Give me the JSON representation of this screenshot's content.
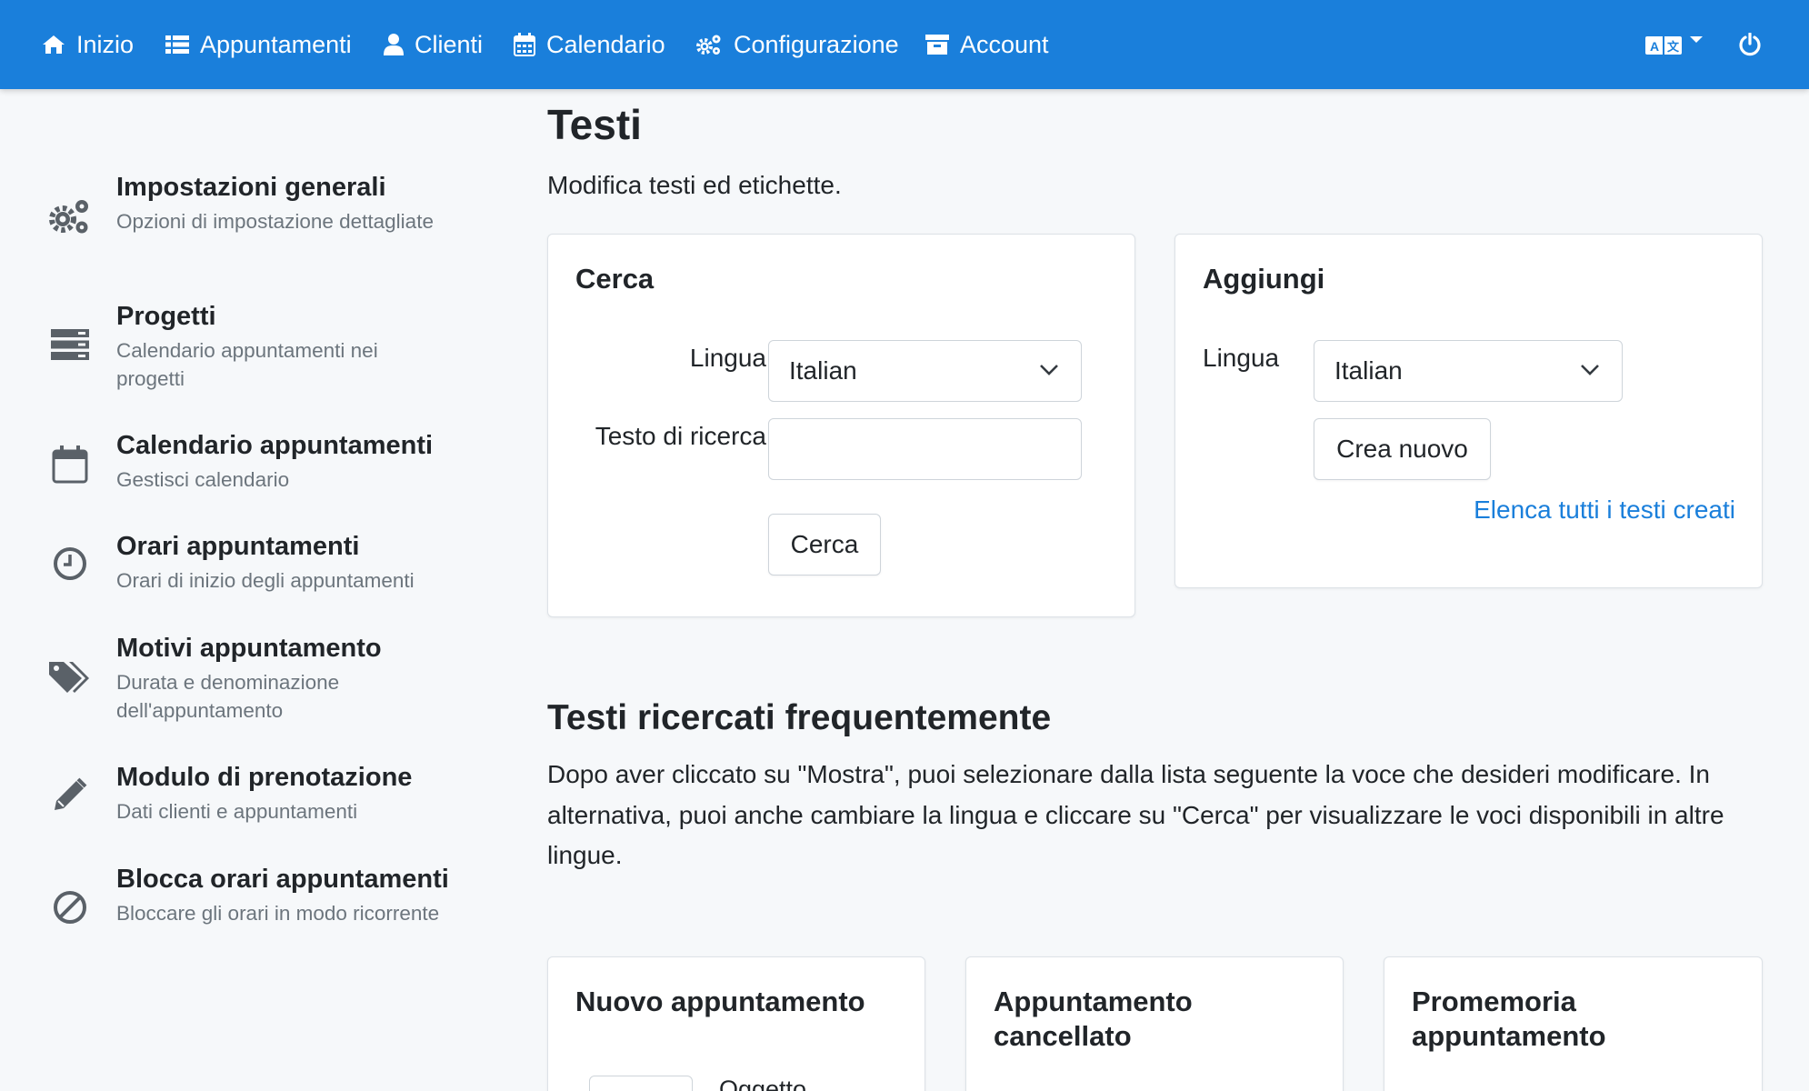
{
  "nav": {
    "items": [
      {
        "label": "Inizio",
        "icon": "home-icon"
      },
      {
        "label": "Appuntamenti",
        "icon": "list-icon"
      },
      {
        "label": "Clienti",
        "icon": "user-icon"
      },
      {
        "label": "Calendario",
        "icon": "calendar-icon"
      },
      {
        "label": "Configurazione",
        "icon": "cogs-icon"
      },
      {
        "label": "Account",
        "icon": "archive-icon"
      }
    ],
    "language_icon": "language-icon",
    "power_icon": "power-icon"
  },
  "sidebar": {
    "items": [
      {
        "title": "Impostazioni generali",
        "desc": "Opzioni di impostazione dettagliate",
        "icon": "cogs-icon"
      },
      {
        "title": "Progetti",
        "desc": "Calendario appuntamenti nei progetti",
        "icon": "server-icon"
      },
      {
        "title": "Calendario appuntamenti",
        "desc": "Gestisci calendario",
        "icon": "calendar-icon"
      },
      {
        "title": "Orari appuntamenti",
        "desc": "Orari di inizio degli appuntamenti",
        "icon": "clock-icon"
      },
      {
        "title": "Motivi appuntamento",
        "desc": "Durata e denominazione dell'appuntamento",
        "icon": "tags-icon"
      },
      {
        "title": "Modulo di prenotazione",
        "desc": "Dati clienti e appuntamenti",
        "icon": "pencil-icon"
      },
      {
        "title": "Blocca orari appuntamenti",
        "desc": "Bloccare gli orari in modo ricorrente",
        "icon": "ban-icon"
      }
    ]
  },
  "main": {
    "title": "Testi",
    "subtitle": "Modifica testi ed etichette.",
    "search_card": {
      "title": "Cerca",
      "language_label": "Lingua",
      "language_value": "Italian",
      "search_text_label": "Testo di ricerca",
      "search_text_value": "",
      "search_button": "Cerca"
    },
    "add_card": {
      "title": "Aggiungi",
      "language_label": "Lingua",
      "language_value": "Italian",
      "create_button": "Crea nuovo",
      "list_link": "Elenca tutti i testi creati"
    },
    "frequent": {
      "title": "Testi ricercati frequentemente",
      "text": "Dopo aver cliccato su \"Mostra\", puoi selezionare dalla lista seguente la voce che desideri modificare. In alternativa, puoi anche cambiare la lingua e cliccare su \"Cerca\" per visualizzare le voci disponibili in altre lingue.",
      "cards": [
        {
          "title": "Nuovo appuntamento",
          "partial_text": "Oggetto"
        },
        {
          "title": "Appuntamento cancellato"
        },
        {
          "title": "Promemoria appuntamento"
        }
      ]
    }
  },
  "colors": {
    "navbar": "#1a7fdb",
    "link": "#1a7fdb",
    "background": "#f6f8fa"
  }
}
